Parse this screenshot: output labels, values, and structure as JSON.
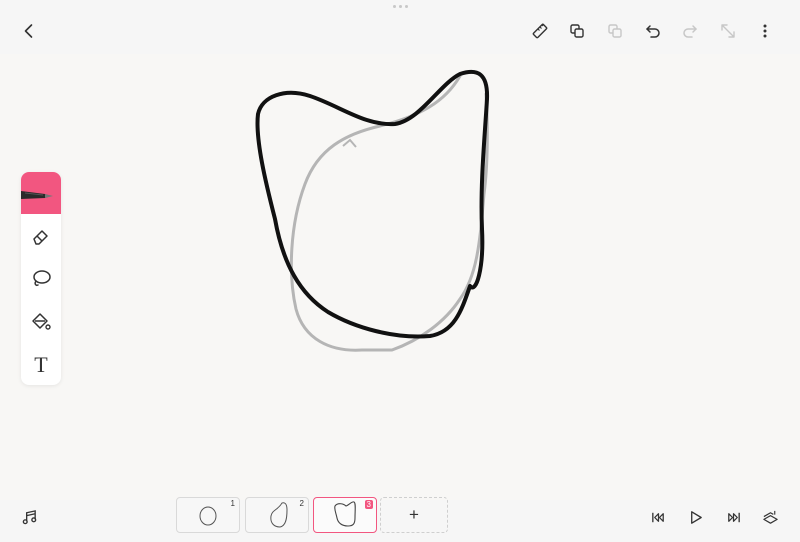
{
  "toolbar": {
    "icons": [
      "back-chevron-icon",
      "ruler-icon",
      "copy-frame-icon",
      "paste-frame-icon",
      "undo-icon",
      "redo-icon",
      "resize-icon",
      "more-icon"
    ]
  },
  "tools": {
    "items": [
      "pen-icon",
      "eraser-icon",
      "lasso-icon",
      "fill-bucket-icon",
      "text-tool-icon"
    ],
    "active_color": "#f25680",
    "text_tool_glyph": "T"
  },
  "timeline": {
    "frames": [
      {
        "number": "1",
        "selected": false
      },
      {
        "number": "2",
        "selected": false
      },
      {
        "number": "3",
        "selected": true
      }
    ],
    "add_label": "+"
  },
  "colors": {
    "accent": "#f25680",
    "stroke": "#111111",
    "onion_skin": "#b5b5b5"
  }
}
